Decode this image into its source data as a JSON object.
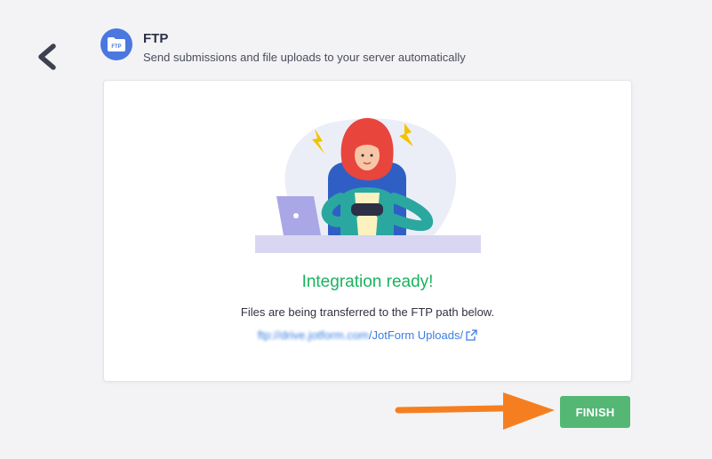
{
  "header": {
    "title": "FTP",
    "subtitle": "Send submissions and file uploads to your server automatically",
    "badge_text": "FTP"
  },
  "card": {
    "status_title": "Integration ready!",
    "description": "Files are being transferred to the FTP path below.",
    "path_host": "ftp://drive.jotform.com",
    "path_folder": "/JotForm Uploads/"
  },
  "footer": {
    "finish_label": "FINISH"
  },
  "colors": {
    "accent_blue": "#4a78e0",
    "success_green": "#19b35e",
    "finish_button": "#54b874",
    "annotation_arrow": "#f57f20"
  },
  "icons": [
    "back-chevron-icon",
    "ftp-folder-icon",
    "external-link-icon",
    "annotation-arrow-icon"
  ]
}
